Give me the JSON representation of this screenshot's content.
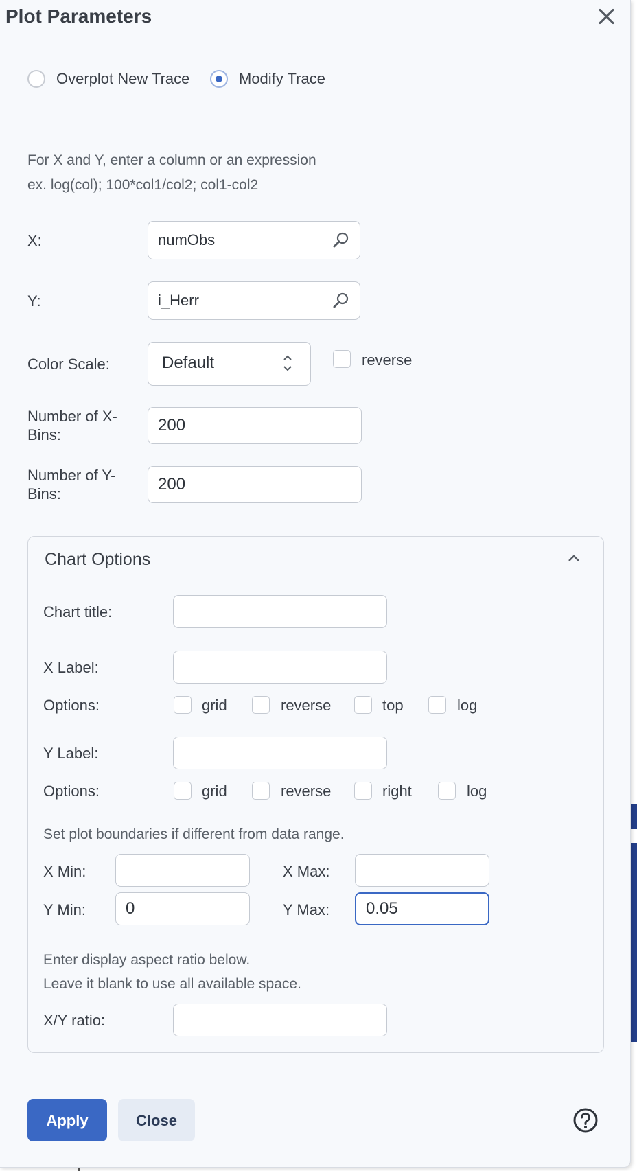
{
  "dialog": {
    "title": "Plot Parameters",
    "mode": {
      "overplot_label": "Overplot New Trace",
      "modify_label": "Modify Trace",
      "selected": "modify"
    },
    "hint_line1": "For X and Y, enter a column or an expression",
    "hint_line2": "ex. log(col); 100*col1/col2; col1-col2",
    "x": {
      "label": "X:",
      "value": "numObs"
    },
    "y": {
      "label": "Y:",
      "value": "i_Herr"
    },
    "color_scale": {
      "label": "Color Scale:",
      "value": "Default",
      "reverse_label": "reverse"
    },
    "x_bins": {
      "label_line1": "Number of X-",
      "label_line2": "Bins:",
      "value": "200"
    },
    "y_bins": {
      "label_line1": "Number of Y-",
      "label_line2": "Bins:",
      "value": "200"
    }
  },
  "chart_options": {
    "header": "Chart Options",
    "chart_title": {
      "label": "Chart title:",
      "value": ""
    },
    "x_label": {
      "label": "X Label:",
      "value": ""
    },
    "x_options": {
      "label": "Options:",
      "grid": "grid",
      "reverse": "reverse",
      "pos": "top",
      "log": "log"
    },
    "y_label": {
      "label": "Y Label:",
      "value": ""
    },
    "y_options": {
      "label": "Options:",
      "grid": "grid",
      "reverse": "reverse",
      "pos": "right",
      "log": "log"
    },
    "bounds_hint": "Set plot boundaries if different from data range.",
    "x_min": {
      "label": "X Min:",
      "value": ""
    },
    "x_max": {
      "label": "X Max:",
      "value": ""
    },
    "y_min": {
      "label": "Y Min:",
      "value": "0"
    },
    "y_max": {
      "label": "Y Max:",
      "value": "0.05"
    },
    "aspect_hint1": "Enter display aspect ratio below.",
    "aspect_hint2": "Leave it blank to use all available space.",
    "ratio": {
      "label": "X/Y ratio:",
      "value": ""
    }
  },
  "footer": {
    "apply": "Apply",
    "close": "Close"
  },
  "colors": {
    "accent": "#3a68c4",
    "background": "#f7f9fc"
  }
}
